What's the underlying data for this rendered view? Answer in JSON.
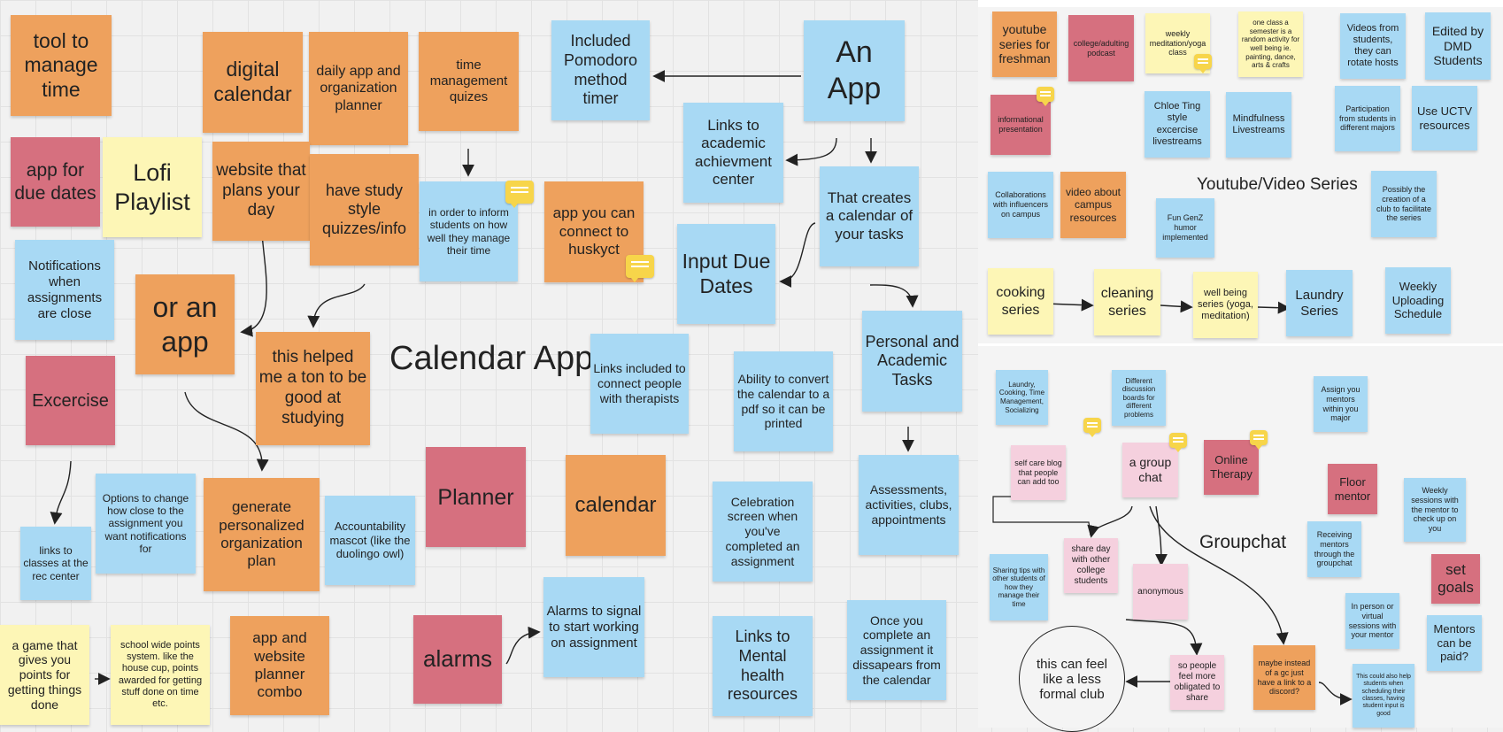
{
  "board": {
    "calendar_title": "Calendar App",
    "youtube_title": "Youtube/Video Series",
    "groupchat_title": "Groupchat"
  },
  "notes": {
    "tool_manage_time": "tool to manage time",
    "digital_calendar": "digital calendar",
    "daily_app": "daily app and organization planner",
    "time_quizes": "time management quizes",
    "pomodoro": "Included Pomodoro method timer",
    "an_app": "An App",
    "app_due_dates": "app for due dates",
    "lofi": "Lofi Playlist",
    "website_plans_day": "website that plans your day",
    "study_quizzes": "have study style quizzes/info",
    "inform_students": "in order to inform students on how well they manage their time",
    "connect_huskyct": "app you can connect to huskyct",
    "links_academic": "Links to academic achievment center",
    "creates_calendar": "That creates a calendar of your tasks",
    "input_due_dates": "Input Due Dates",
    "notifications_close": "Notifications when assignments are close",
    "or_an_app": "or an app",
    "helped_studying": "this helped me a ton to be good at studying",
    "links_therapists": "Links included to connect people with therapists",
    "pdf_convert": "Ability to convert the calendar to a pdf so it can be printed",
    "personal_academic": "Personal and Academic Tasks",
    "excercise": "Excercise",
    "options_change": "Options to change how close to the assignment you want notifications for",
    "generate_plan": "generate personalized organization plan",
    "accountability_mascot": "Accountability mascot (like the duolingo owl)",
    "planner": "Planner",
    "calendar": "calendar",
    "celebration_screen": "Celebration screen when you've completed an assignment",
    "assessments": "Assessments, activities, clubs, appointments",
    "links_rec": "links to classes at the rec center",
    "game_points": "a game that gives you points for getting things done",
    "school_points": "school wide points system. like the house cup, points awarded for getting stuff done on time etc.",
    "app_website_combo": "app and website planner combo",
    "alarms": "alarms",
    "alarms_signal": "Alarms to signal to start working on assignment",
    "mental_health": "Links to Mental health resources",
    "complete_disappears": "Once you complete an assignment it dissapears from the calendar",
    "yt_freshman": "youtube series for freshman",
    "college_podcast": "college/adulting podcast",
    "weekly_yoga": "weekly meditation/yoga class",
    "one_class": "one class a semester is a random activity for well being ie. painting, dance, arts & crafts",
    "videos_rotate": "Videos from students, they can rotate hosts",
    "edited_dmd": "Edited by DMD Students",
    "informational_presentation": "informational presentation",
    "chloe_ting": "Chloe Ting style excercise livestreams",
    "mindfulness": "Mindfulness Livestreams",
    "participation_majors": "Participation from students in different majors",
    "uctv": "Use UCTV resources",
    "collab_influencers": "Collaborations with influencers on campus",
    "video_campus": "video about campus resources",
    "genz_humor": "Fun GenZ humor implemented",
    "club_creation": "Possibly the creation of a club to facilitate the series",
    "cooking": "cooking series",
    "cleaning": "cleaning series",
    "well_being": "well being series (yoga, meditation)",
    "laundry": "Laundry Series",
    "weekly_upload": "Weekly Uploading Schedule",
    "laundry_topics": "Laundry, Cooking, Time Management, Socializing",
    "discussion_boards": "Different discussion boards for different problems",
    "assign_mentors": "Assign you mentors within you major",
    "self_care_blog": "self care blog that people can add too",
    "group_chat": "a group chat",
    "online_therapy": "Online Therapy",
    "floor_mentor": "Floor mentor",
    "weekly_sessions": "Weekly sessions with the mentor to check up on you",
    "receiving_mentors": "Receiving mentors through the groupchat",
    "set_goals": "set goals",
    "sharing_tips": "Sharing tips with other students of how they manage their time",
    "share_day": "share day with other college students",
    "anonymous": "anonymous",
    "in_person": "In person or virtual sessions with your mentor",
    "mentors_paid": "Mentors can be paid?",
    "less_formal": "this can feel like a less formal club",
    "obligated_share": "so people feel more obligated to share",
    "gc_discord": "maybe instead of a gc just have a link to a discord?",
    "scheduling_help": "This could also help students when scheduling their classes, having student input is good"
  },
  "colors": {
    "orange": "#eea15d",
    "blue": "#a8d9f4",
    "red": "#d6707f",
    "yellow": "#fdf6b6",
    "pink": "#f5d0de",
    "comment": "#f7d54a"
  }
}
